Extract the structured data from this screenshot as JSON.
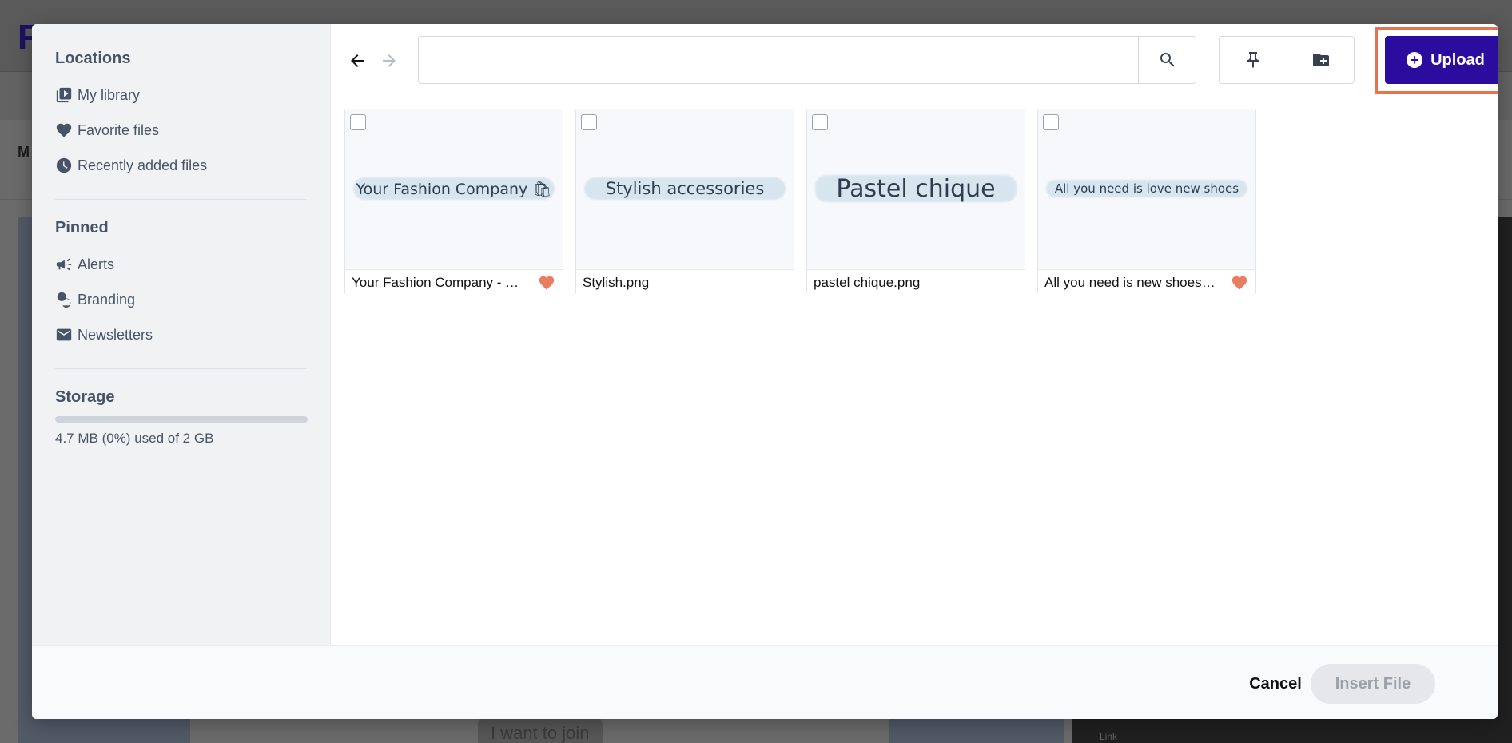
{
  "sidebar": {
    "locations_heading": "Locations",
    "locations": [
      {
        "label": "My library",
        "icon": "library-icon"
      },
      {
        "label": "Favorite files",
        "icon": "heart-icon"
      },
      {
        "label": "Recently added files",
        "icon": "clock-icon"
      }
    ],
    "pinned_heading": "Pinned",
    "pinned": [
      {
        "label": "Alerts",
        "icon": "megaphone-icon"
      },
      {
        "label": "Branding",
        "icon": "stamp-icon"
      },
      {
        "label": "Newsletters",
        "icon": "mail-icon"
      }
    ],
    "storage_heading": "Storage",
    "storage_used_fraction": 0,
    "storage_text": "4.7 MB (0%) used of 2 GB"
  },
  "toolbar": {
    "search_value": "",
    "back_icon": "arrow-left-icon",
    "forward_icon": "arrow-right-icon",
    "search_icon": "search-icon",
    "pin_icon": "pin-icon",
    "new_folder_icon": "folder-plus-icon",
    "upload_label": "Upload",
    "upload_color": "#2a0c9e",
    "highlight_color": "#e5734f"
  },
  "files": [
    {
      "thumb_text": "Your Fashion Company 🛍",
      "name": "Your Fashion Company - …",
      "favorite": true
    },
    {
      "thumb_text": "Stylish accessories",
      "name": "Stylish.png",
      "favorite": false
    },
    {
      "thumb_text": "Pastel chique",
      "name": "pastel chique.png",
      "favorite": false
    },
    {
      "thumb_text": "All you need is love new shoes",
      "name": "All you need is new shoes…",
      "favorite": true
    }
  ],
  "footer": {
    "cancel_label": "Cancel",
    "insert_label": "Insert File"
  },
  "background": {
    "logo": "F",
    "menu_text": "M",
    "join_text": "I want to join",
    "dark_label": "Link"
  }
}
